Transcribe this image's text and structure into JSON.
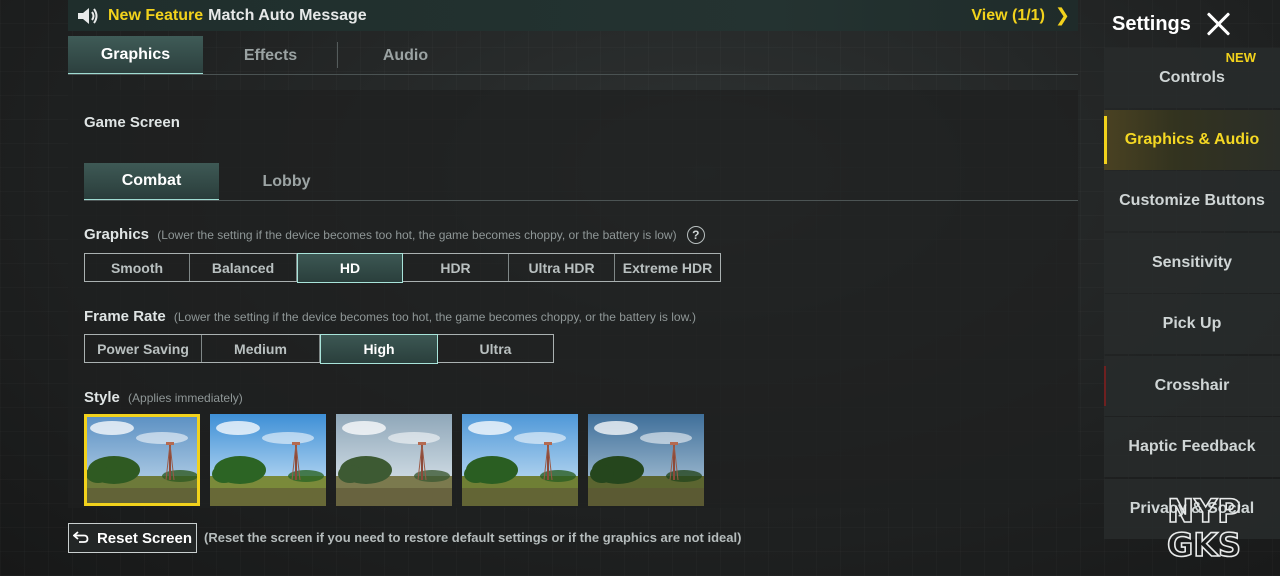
{
  "announcement": {
    "tag": "New Feature",
    "message": "Match Auto Message",
    "view_label": "View (1/1)",
    "speaker_icon": "speaker-icon",
    "chevron_icon": "chevron-right-icon"
  },
  "top_tabs": [
    {
      "label": "Graphics",
      "active": true
    },
    {
      "label": "Effects",
      "active": false
    },
    {
      "label": "Audio",
      "active": false
    }
  ],
  "panel": {
    "section_title": "Game Screen",
    "sub_tabs": [
      {
        "label": "Combat",
        "active": true
      },
      {
        "label": "Lobby",
        "active": false
      }
    ],
    "graphics": {
      "label": "Graphics",
      "hint": "(Lower the setting if the device becomes too hot, the game becomes choppy, or the battery is low)",
      "help_icon": "?",
      "options": [
        "Smooth",
        "Balanced",
        "HD",
        "HDR",
        "Ultra HDR",
        "Extreme HDR"
      ],
      "selected": "HD"
    },
    "frame_rate": {
      "label": "Frame Rate",
      "hint": "(Lower the setting if the device becomes too hot, the game becomes choppy, or the battery is low.)",
      "options": [
        "Power Saving",
        "Medium",
        "High",
        "Ultra"
      ],
      "selected": "High"
    },
    "style": {
      "label": "Style",
      "hint": "(Applies immediately)",
      "thumbnail_count": 5,
      "selected_index": 0
    }
  },
  "reset": {
    "label": "Reset Screen",
    "note": "(Reset the screen if you need to restore default settings or if the graphics are not ideal)",
    "icon": "undo-icon"
  },
  "sidebar": {
    "title": "Settings",
    "close_icon": "close-icon",
    "items": [
      {
        "label": "Controls",
        "badge": "NEW",
        "active": false
      },
      {
        "label": "Graphics & Audio",
        "active": true
      },
      {
        "label": "Customize Buttons",
        "active": false
      },
      {
        "label": "Sensitivity",
        "active": false
      },
      {
        "label": "Pick Up",
        "active": false
      },
      {
        "label": "Crosshair",
        "active": false
      },
      {
        "label": "Haptic Feedback",
        "active": false
      },
      {
        "label": "Privacy & Social",
        "active": false
      }
    ]
  },
  "watermark": {
    "line1": "NYP",
    "line2": "GKS"
  },
  "colors": {
    "accent_yellow": "#f2d21c",
    "selected_teal": "#3c5753",
    "selected_border": "#a8e4da",
    "background": "#1e2020"
  }
}
